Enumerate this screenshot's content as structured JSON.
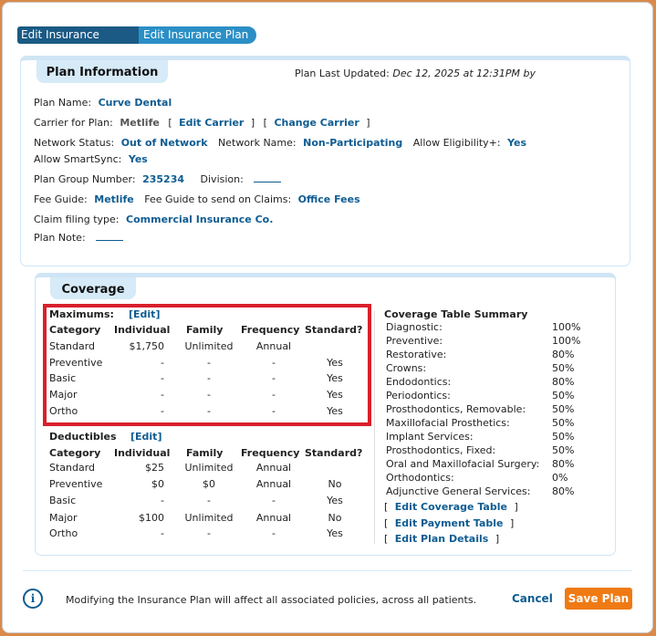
{
  "tabs": [
    "Edit Insurance Policy",
    "Edit Insurance Plan"
  ],
  "plan_info": {
    "title": "Plan Information",
    "last_updated_label": "Plan Last Updated:",
    "last_updated_value": "Dec 12, 2025 at 12:31PM by",
    "plan_name_label": "Plan Name:",
    "plan_name": "Curve Dental",
    "carrier_label": "Carrier for Plan:",
    "carrier": "Metlife",
    "edit_carrier": "Edit Carrier",
    "change_carrier": "Change Carrier",
    "network_status_label": "Network Status:",
    "network_status": "Out of Network",
    "network_name_label": "Network Name:",
    "network_name": "Non-Participating",
    "allow_eligibility_label": "Allow Eligibility+:",
    "allow_eligibility": "Yes",
    "allow_smartsync_label": "Allow SmartSync:",
    "allow_smartsync": "Yes",
    "plan_group_label": "Plan Group Number:",
    "plan_group": "235234",
    "division_label": "Division:",
    "fee_guide_label": "Fee Guide:",
    "fee_guide": "Metlife",
    "fee_guide_claims_label": "Fee Guide to send on Claims:",
    "fee_guide_claims": "Office Fees",
    "claim_filing_label": "Claim filing type:",
    "claim_filing": "Commercial Insurance Co.",
    "plan_note_label": "Plan Note:"
  },
  "coverage": {
    "title": "Coverage",
    "maximums_label": "Maximums:",
    "deductibles_label": "Deductibles",
    "edit": "[Edit]",
    "columns": [
      "Category",
      "Individual",
      "Family",
      "Frequency",
      "Standard?"
    ],
    "maximums": [
      [
        "Standard",
        "$1,750",
        "Unlimited",
        "Annual",
        ""
      ],
      [
        "Preventive",
        "-",
        "-",
        "-",
        "Yes"
      ],
      [
        "Basic",
        "-",
        "-",
        "-",
        "Yes"
      ],
      [
        "Major",
        "-",
        "-",
        "-",
        "Yes"
      ],
      [
        "Ortho",
        "-",
        "-",
        "-",
        "Yes"
      ]
    ],
    "deductibles": [
      [
        "Standard",
        "$25",
        "Unlimited",
        "Annual",
        ""
      ],
      [
        "Preventive",
        "$0",
        "$0",
        "Annual",
        "No"
      ],
      [
        "Basic",
        "-",
        "-",
        "-",
        "Yes"
      ],
      [
        "Major",
        "$100",
        "Unlimited",
        "Annual",
        "No"
      ],
      [
        "Ortho",
        "-",
        "-",
        "-",
        "Yes"
      ]
    ],
    "summary_title": "Coverage Table Summary",
    "summary": [
      [
        "Diagnostic:",
        "100%"
      ],
      [
        "Preventive:",
        "100%"
      ],
      [
        "Restorative:",
        "80%"
      ],
      [
        "Crowns:",
        "50%"
      ],
      [
        "Endodontics:",
        "80%"
      ],
      [
        "Periodontics:",
        "50%"
      ],
      [
        "Prosthodontics, Removable:",
        "50%"
      ],
      [
        "Maxillofacial Prosthetics:",
        "50%"
      ],
      [
        "Implant Services:",
        "50%"
      ],
      [
        "Prosthodontics, Fixed:",
        "50%"
      ],
      [
        "Oral and Maxillofacial Surgery:",
        "80%"
      ],
      [
        "Orthodontics:",
        "0%"
      ],
      [
        "Adjunctive General Services:",
        "80%"
      ]
    ],
    "edit_coverage_table": "Edit Coverage Table",
    "edit_payment_table": "Edit Payment Table",
    "edit_plan_details": "Edit Plan Details"
  },
  "footer": {
    "info_icon": "i",
    "message": "Modifying the Insurance Plan will affect all associated policies, across all patients.",
    "cancel": "Cancel",
    "save": "Save Plan"
  }
}
